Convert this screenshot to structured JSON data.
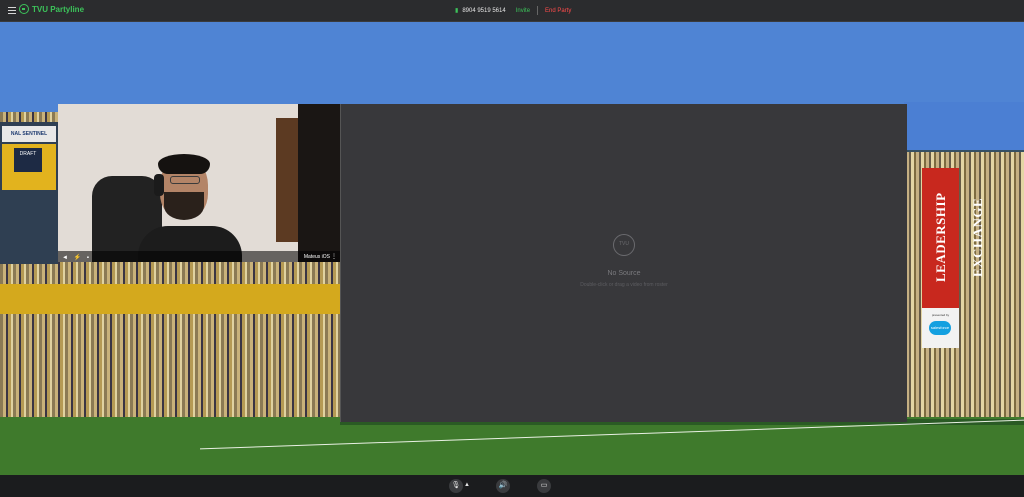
{
  "topbar": {
    "app_name": "TVU Partyline",
    "party_code": "8904 9519 5614",
    "invite_label": "Invite",
    "end_party_label": "End Party"
  },
  "stage": {
    "banner_text": "NAL SENTINEL",
    "draft_text": "DRAFT",
    "camera_tile": {
      "participant_name": "Mateus iOS"
    },
    "no_source": {
      "title": "No Source",
      "subtitle": "Double-click or drag a video from roster",
      "icon_text": "TVU"
    },
    "sponsor_banner": {
      "title": "LEADERSHIP EXCHANGE",
      "presented_by": "presented by",
      "sponsor_logo_text": "salesforce"
    }
  },
  "bottombar": {
    "mic_icon": "mic-icon",
    "speaker_icon": "speaker-icon",
    "chat_icon": "chat-icon"
  },
  "colors": {
    "accent_green": "#3cc35a",
    "end_red": "#ff4b4b",
    "sky_blue": "#4f84d4"
  }
}
